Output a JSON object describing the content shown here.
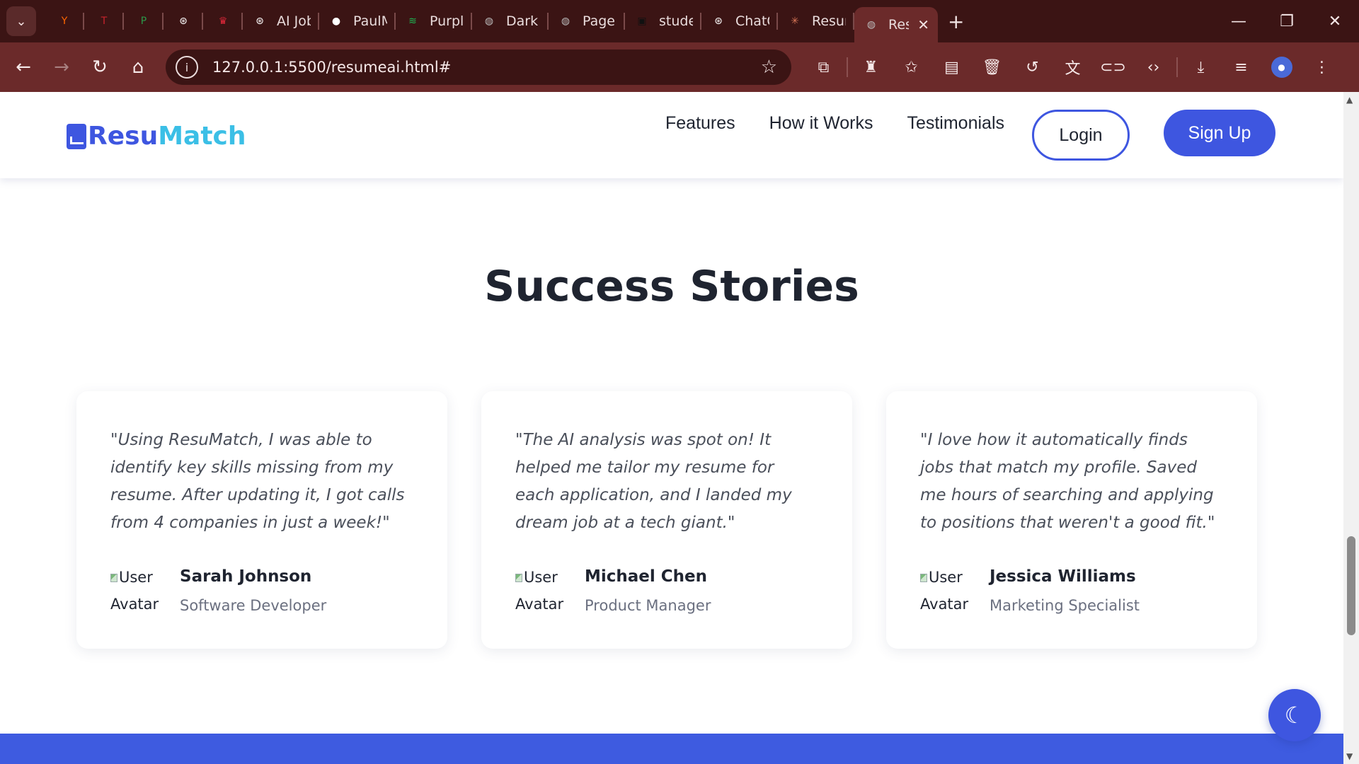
{
  "browser": {
    "tabs": [
      {
        "title": "",
        "icon": "y-combinator-icon",
        "color": "#ff6600",
        "glyph": "Y"
      },
      {
        "title": "",
        "icon": "tj-icon",
        "color": "#c8232c",
        "glyph": "T"
      },
      {
        "title": "",
        "icon": "p-icon",
        "color": "#2a9a4a",
        "glyph": "P"
      },
      {
        "title": "",
        "icon": "openai-icon",
        "color": "#ffffff",
        "glyph": "⊛"
      },
      {
        "title": "",
        "icon": "crown-icon",
        "color": "#e0283a",
        "glyph": "♛"
      },
      {
        "title": "AI Job M",
        "icon": "openai-icon",
        "color": "#ffffff",
        "glyph": "⊛"
      },
      {
        "title": "PaulMc",
        "icon": "github-icon",
        "color": "#ffffff",
        "glyph": "●"
      },
      {
        "title": "Purple I",
        "icon": "spotify-icon",
        "color": "#1db954",
        "glyph": "≋"
      },
      {
        "title": "Dark Ka",
        "icon": "globe-icon",
        "color": "#bbbbbb",
        "glyph": "◍"
      },
      {
        "title": "Page nc",
        "icon": "globe-icon",
        "color": "#bbbbbb",
        "glyph": "◍"
      },
      {
        "title": "student",
        "icon": "site-icon",
        "color": "#111111",
        "glyph": "▣"
      },
      {
        "title": "ChatGP",
        "icon": "openai-icon",
        "color": "#ffffff",
        "glyph": "⊛"
      },
      {
        "title": "Resume",
        "icon": "claude-icon",
        "color": "#d97757",
        "glyph": "✳"
      },
      {
        "title": "Res",
        "icon": "globe-icon",
        "color": "#bbbbbb",
        "glyph": "◍",
        "active": true
      }
    ],
    "url": "127.0.0.1:5500/resumeai.html#"
  },
  "site": {
    "logo_part1": "Resu",
    "logo_part2": "Match",
    "nav": {
      "features": "Features",
      "how_it_works": "How it Works",
      "testimonials": "Testimonials",
      "login": "Login",
      "signup": "Sign Up"
    }
  },
  "testimonials": {
    "title": "Success Stories",
    "items": [
      {
        "quote": "\"Using ResuMatch, I was able to identify key skills missing from my resume. After updating it, I got calls from 4 companies in just a week!\"",
        "avatar_alt": "User Avatar",
        "name": "Sarah Johnson",
        "role": "Software Developer"
      },
      {
        "quote": "\"The AI analysis was spot on! It helped me tailor my resume for each application, and I landed my dream job at a tech giant.\"",
        "avatar_alt": "User Avatar",
        "name": "Michael Chen",
        "role": "Product Manager"
      },
      {
        "quote": "\"I love how it automatically finds jobs that match my profile. Saved me hours of searching and applying to positions that weren't a good fit.\"",
        "avatar_alt": "User Avatar",
        "name": "Jessica Williams",
        "role": "Marketing Specialist"
      }
    ]
  },
  "colors": {
    "brand_primary": "#3e56e0",
    "brand_secondary": "#3bbfe6",
    "chrome_dark": "#3b1414",
    "chrome_toolbar": "#6b2a2a"
  }
}
